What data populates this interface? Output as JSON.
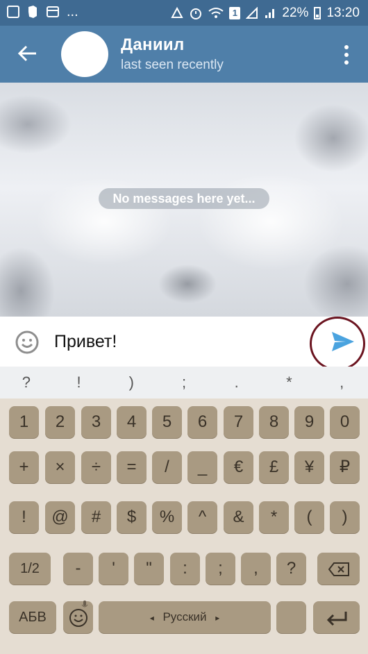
{
  "status": {
    "battery": "22%",
    "time": "13:20",
    "sim_badge": "1",
    "more": "..."
  },
  "header": {
    "name": "Даниил",
    "status": "last seen recently"
  },
  "chat": {
    "empty_text": "No messages here yet..."
  },
  "input": {
    "value": "Привет!"
  },
  "suggestions": [
    "?",
    "!",
    ")",
    ";",
    ".",
    "*",
    ","
  ],
  "keyboard": {
    "row1": [
      "1",
      "2",
      "3",
      "4",
      "5",
      "6",
      "7",
      "8",
      "9",
      "0"
    ],
    "row2": [
      "+",
      "×",
      "÷",
      "=",
      "/",
      "_",
      "€",
      "£",
      "¥",
      "₽"
    ],
    "row3": [
      "!",
      "@",
      "#",
      "$",
      "%",
      "^",
      "&",
      "*",
      "(",
      ")"
    ],
    "row4": [
      "1/2",
      "-",
      "'",
      "\"",
      ":",
      ";",
      ",",
      "?"
    ],
    "abc_label": "АБВ",
    "space_label": "Русский",
    "space_left_arrow": "◂",
    "space_right_arrow": "▸"
  },
  "colors": {
    "header": "#4f7fa9",
    "statusbar": "#3f6a92",
    "key": "#a99a82",
    "keyboard_bg": "#e5ddd2",
    "send": "#4aa3df",
    "send_highlight": "#6b1420"
  }
}
